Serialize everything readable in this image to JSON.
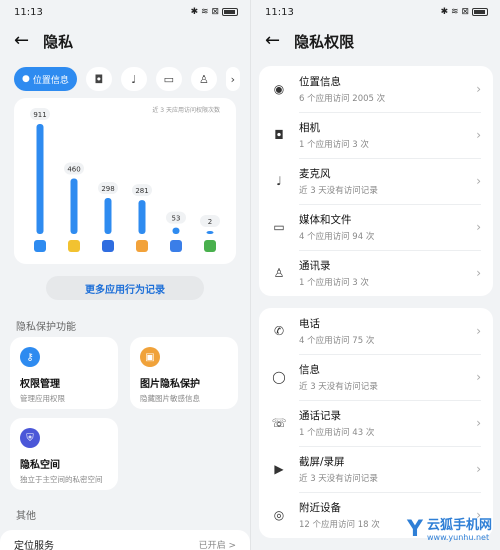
{
  "left": {
    "status": {
      "time": "11:13",
      "icons": "✱ ≋ ⊠"
    },
    "title": "隐私",
    "chips": {
      "active_label": "位置信息",
      "icons": [
        "camera-icon",
        "mic-icon",
        "folder-icon",
        "contact-icon",
        "chevron-right-icon"
      ]
    },
    "chart_note": "近 3 天应用访问权限次数",
    "chart_data": {
      "type": "bar",
      "values": [
        911,
        460,
        298,
        281,
        53,
        2
      ],
      "labels": [
        "911",
        "460",
        "298",
        "281",
        "53",
        "2"
      ],
      "ylim": [
        0,
        911
      ],
      "bar_color": "#2e8bf0",
      "app_icon_colors": [
        "#2e8bf0",
        "#f2c230",
        "#2f6de0",
        "#f2a23a",
        "#3a7ee8",
        "#49b04d"
      ]
    },
    "more_button": "更多应用行为记录",
    "protection_section": "隐私保护功能",
    "tiles": [
      {
        "title": "权限管理",
        "sub": "管理应用权限",
        "icon": "key-icon",
        "color": "#2e8bf0"
      },
      {
        "title": "图片隐私保护",
        "sub": "隐藏图片敏感信息",
        "icon": "image-icon",
        "color": "#f0a23a"
      },
      {
        "title": "隐私空间",
        "sub": "独立于主空间的私密空间",
        "icon": "shield-icon",
        "color": "#4b57d8"
      }
    ],
    "other_section": "其他",
    "location_service": {
      "label": "定位服务",
      "value": "已开启 >"
    }
  },
  "right": {
    "status": {
      "time": "11:13",
      "icons": "✱ ≋ ⊠"
    },
    "title": "隐私权限",
    "group1": [
      {
        "title": "位置信息",
        "sub": "6 个应用访问 2005 次",
        "icon": "◉"
      },
      {
        "title": "相机",
        "sub": "1 个应用访问 3 次",
        "icon": "◘"
      },
      {
        "title": "麦克风",
        "sub": "近 3 天没有访问记录",
        "icon": "♩"
      },
      {
        "title": "媒体和文件",
        "sub": "4 个应用访问 94 次",
        "icon": "▭"
      },
      {
        "title": "通讯录",
        "sub": "1 个应用访问 3 次",
        "icon": "♙"
      }
    ],
    "group2": [
      {
        "title": "电话",
        "sub": "4 个应用访问 75 次",
        "icon": "✆"
      },
      {
        "title": "信息",
        "sub": "近 3 天没有访问记录",
        "icon": "◯"
      },
      {
        "title": "通话记录",
        "sub": "1 个应用访问 43 次",
        "icon": "☏"
      },
      {
        "title": "截屏/录屏",
        "sub": "近 3 天没有访问记录",
        "icon": "▶"
      },
      {
        "title": "附近设备",
        "sub": "12 个应用访问 18 次",
        "icon": "◎"
      }
    ],
    "chevron": "›"
  },
  "watermark": {
    "letter": "Y",
    "name": "云狐手机网",
    "url": "www.yunhu.net"
  }
}
